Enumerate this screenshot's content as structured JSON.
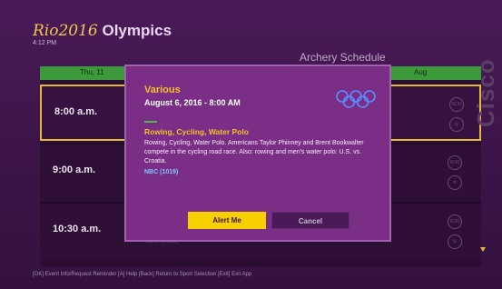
{
  "header": {
    "brand_prefix": "Rio2016",
    "brand_suffix": "Olympics",
    "clock": "4:12 PM",
    "schedule_title": "Archery Schedule"
  },
  "schedule": {
    "day_left": "Thu, 11",
    "day_right": "Aug",
    "rows": [
      {
        "time": "8:00 a.m."
      },
      {
        "time": "9:00 a.m."
      },
      {
        "time": "10:30 a.m."
      }
    ],
    "icon_top_label": "ROD",
    "bottom_peek": "NBC (1019)"
  },
  "modal": {
    "title": "Various",
    "date": "August 6, 2016 - 8:00 AM",
    "sports": "Rowing, Cycling, Water Polo",
    "description": "Rowing, Cycling, Water Polo. Americans Taylor Phinney and Brent Bookwalter compete in the cycling road race. Also: rowing and men's water polo: U.S. vs. Croatia.",
    "channel": "NBC (1019)",
    "alert_label": "Alert Me",
    "cancel_label": "Cancel",
    "rings_icon": "olympic-rings-icon"
  },
  "side_brand": "Cisco",
  "footer": "[OK] Event Info/Request Reminder    [A] Help    [Back] Return to Sport Selection    [Exit] Exit App",
  "colors": {
    "background": "#3a1446",
    "modal": "#7a2e86",
    "accent_gold": "#f4c12c",
    "alert_button": "#f8d000",
    "day_header": "#3c9a3a",
    "channel": "#7ec8ff"
  }
}
